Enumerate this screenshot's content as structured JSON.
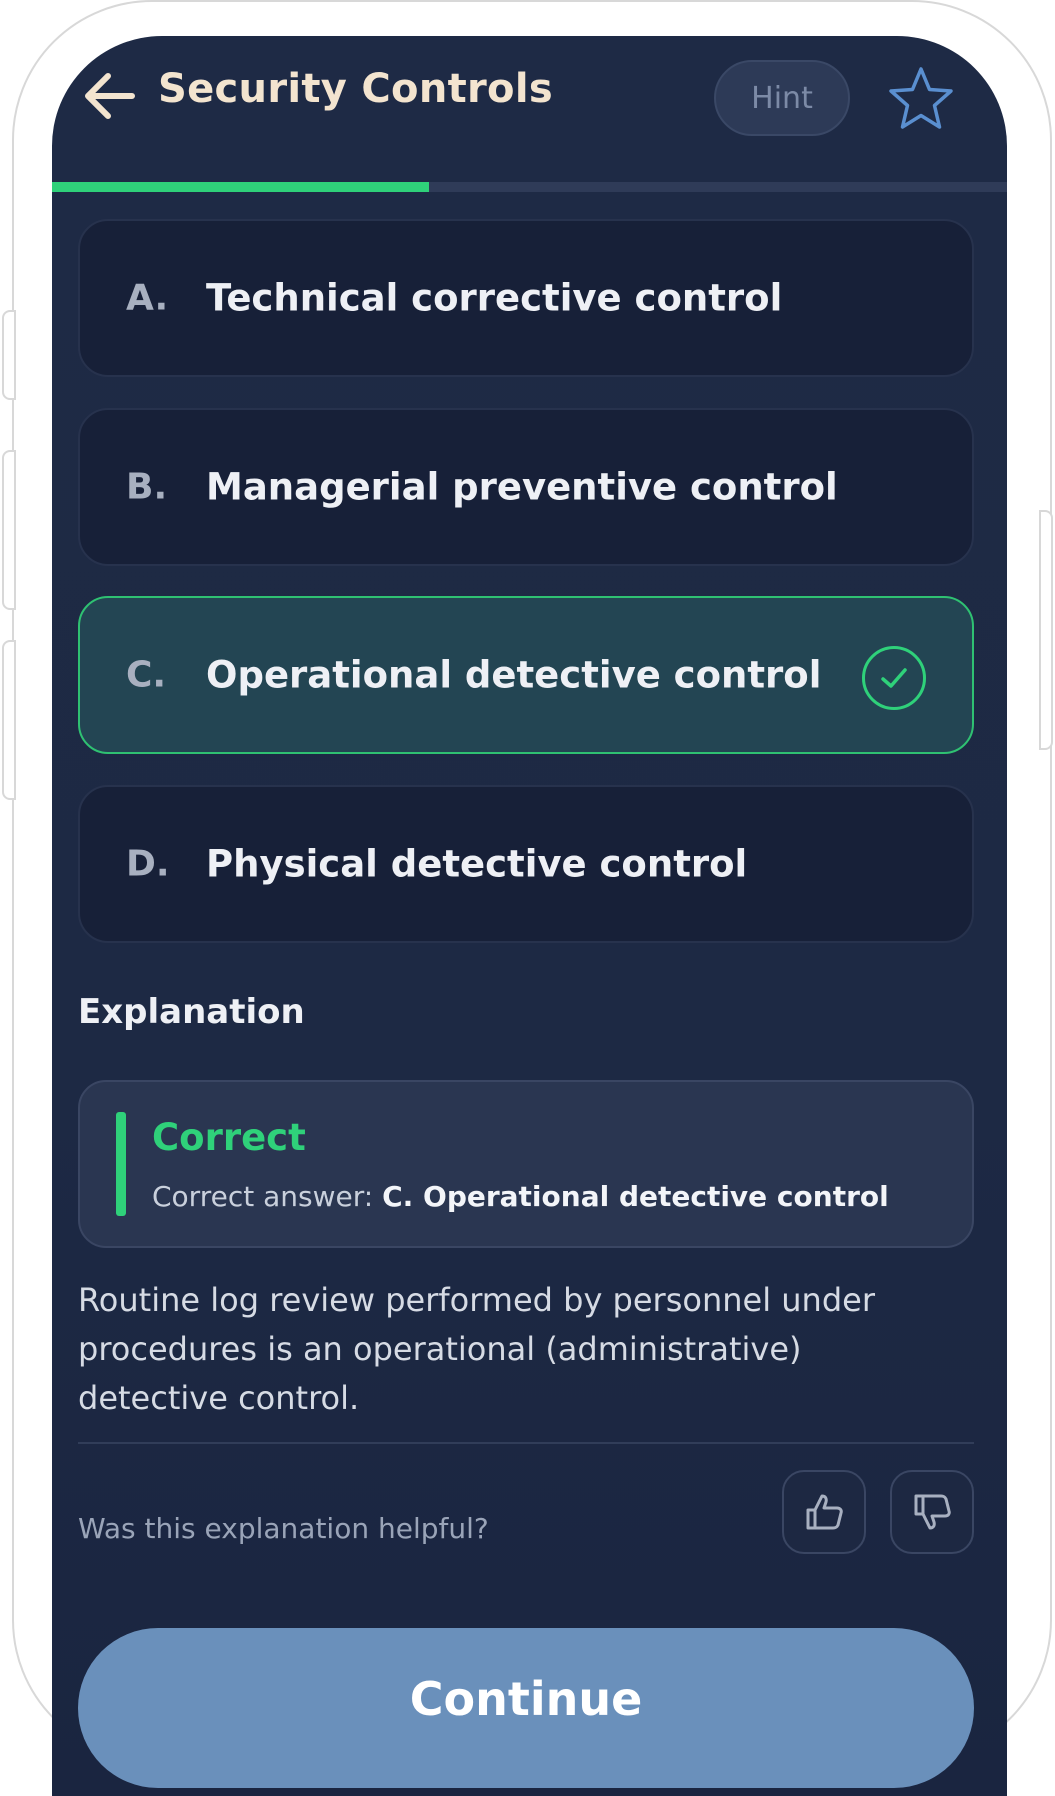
{
  "header": {
    "title": "Security Controls",
    "hint_label": "Hint",
    "back_icon": "arrow-left-icon",
    "favorite_icon": "star-icon"
  },
  "progress": {
    "fraction": 0.395,
    "color": "#2fd17a"
  },
  "options": [
    {
      "letter": "A.",
      "text": "Technical corrective control",
      "state": "default"
    },
    {
      "letter": "B.",
      "text": "Managerial preventive control",
      "state": "default"
    },
    {
      "letter": "C.",
      "text": "Operational detective control",
      "state": "correct"
    },
    {
      "letter": "D.",
      "text": "Physical detective control",
      "state": "default"
    }
  ],
  "explanation": {
    "heading": "Explanation",
    "status": "Correct",
    "answer_prefix": "Correct answer:",
    "answer_value": "C. Operational detective control",
    "body": "Routine log review performed by personnel under procedures is an operational (administrative) detective control.",
    "feedback_question": "Was this explanation helpful?"
  },
  "footer": {
    "continue_label": "Continue"
  },
  "colors": {
    "accent_green": "#2fd17a",
    "title_cream": "#f3e4cf",
    "continue_blue": "#6a90bb",
    "background_navy": "#1e2a45"
  }
}
